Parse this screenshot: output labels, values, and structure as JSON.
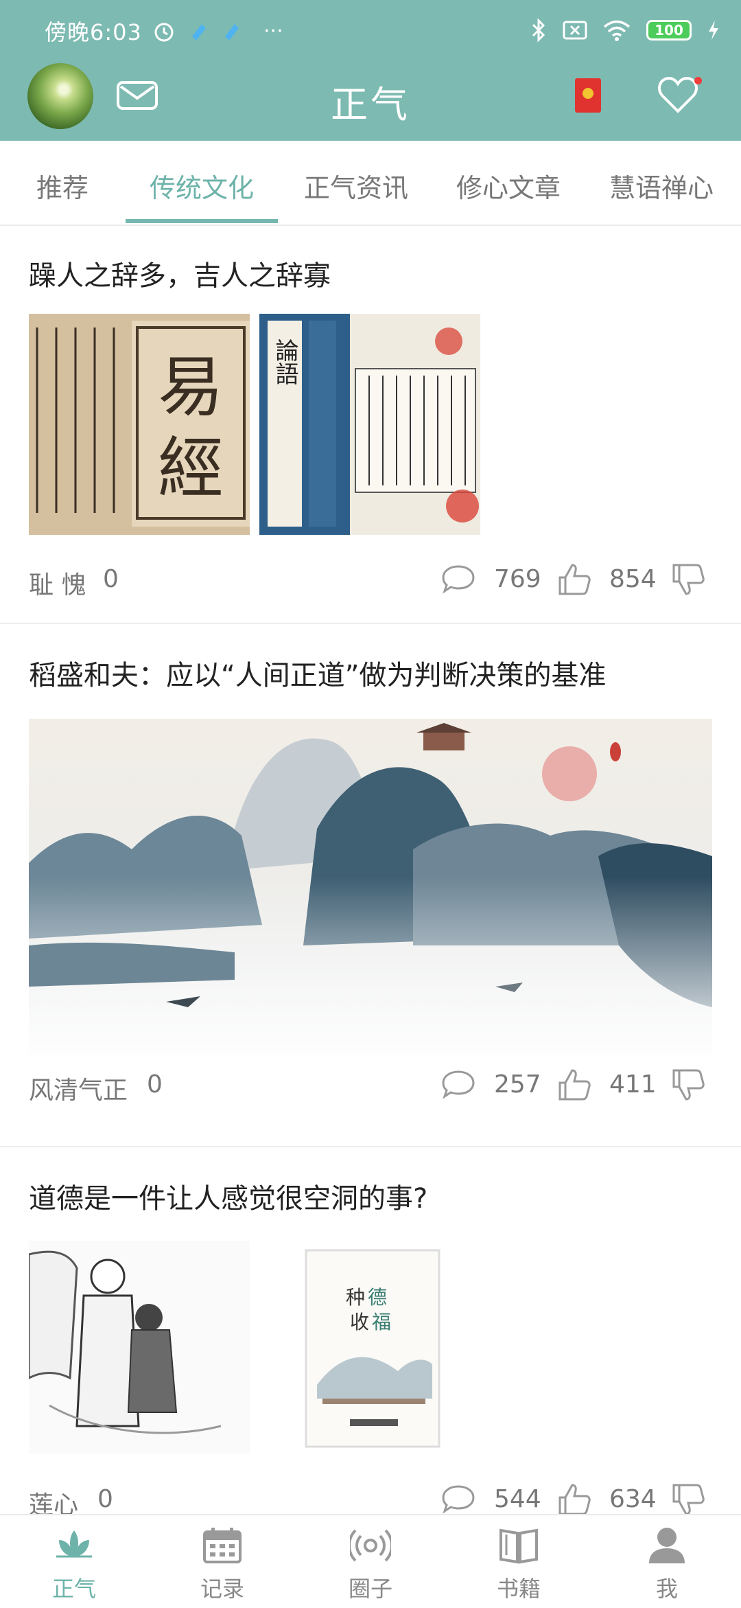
{
  "status_bar": {
    "time": "傍晚6:03",
    "more": "···",
    "battery": "100"
  },
  "app_bar": {
    "title": "正气",
    "icons": [
      "avatar",
      "mail-icon",
      "red-packet-icon",
      "heart-icon"
    ]
  },
  "tabs": [
    {
      "label": "推荐",
      "active": false
    },
    {
      "label": "传统文化",
      "active": true
    },
    {
      "label": "正气资讯",
      "active": false
    },
    {
      "label": "修心文章",
      "active": false
    },
    {
      "label": "慧语禅心",
      "active": false
    }
  ],
  "articles": [
    {
      "title": "躁人之辞多，吉人之辞寡",
      "author": "耻 愧",
      "author_count": "0",
      "comments": "769",
      "likes": "854",
      "images": [
        "易經 book cover",
        "論語 book pages"
      ],
      "image_text": [
        "易",
        "經",
        "論語"
      ]
    },
    {
      "title": "稻盛和夫：应以“人间正道”做为判断决策的基准",
      "author": "风清气正",
      "author_count": "0",
      "comments": "257",
      "likes": "411",
      "images": [
        "ink landscape painting"
      ]
    },
    {
      "title": "道德是一件让人感觉很空洞的事?",
      "author": "莲心",
      "author_count": "0",
      "comments": "544",
      "likes": "634",
      "images": [
        "ink sketch of scholar and child",
        "种德收福 book cover"
      ],
      "image_text": [
        "种",
        "德",
        "收",
        "福"
      ]
    }
  ],
  "bottom_nav": [
    {
      "label": "正气",
      "icon": "lotus-icon",
      "active": true
    },
    {
      "label": "记录",
      "icon": "calendar-icon",
      "active": false
    },
    {
      "label": "圈子",
      "icon": "broadcast-icon",
      "active": false
    },
    {
      "label": "书籍",
      "icon": "book-icon",
      "active": false
    },
    {
      "label": "我",
      "icon": "person-icon",
      "active": false
    }
  ],
  "colors": {
    "header_bg": "#7dbab2",
    "accent": "#6db3aa",
    "text_secondary": "#777777"
  }
}
